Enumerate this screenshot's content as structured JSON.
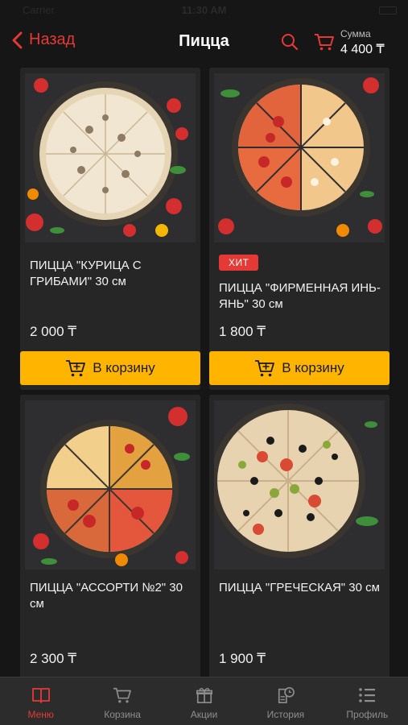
{
  "status": {
    "carrier": "Carrier",
    "time": "11:30 AM"
  },
  "header": {
    "back_label": "Назад",
    "title": "Пицца",
    "sum_label": "Сумма",
    "sum_value": "4 400 ₸",
    "icons": {
      "back": "chevron-left-icon",
      "search": "search-icon",
      "cart": "cart-icon"
    }
  },
  "colors": {
    "accent": "#e53935",
    "button": "#ffb400",
    "card": "#262626",
    "background": "#161616"
  },
  "products": [
    {
      "name": "ПИЦЦА \"КУРИЦА С ГРИБАМИ\" 30 см",
      "price": "2 000 ₸",
      "badge": "",
      "button": "В корзину"
    },
    {
      "name": "ПИЦЦА \"ФИРМЕННАЯ ИНЬ-ЯНЬ\" 30 см",
      "price": "1 800 ₸",
      "badge": "ХИТ",
      "button": "В корзину"
    },
    {
      "name": "ПИЦЦА \"АССОРТИ №2\" 30 см",
      "price": "2 300 ₸",
      "badge": "",
      "button": ""
    },
    {
      "name": "ПИЦЦА \"ГРЕЧЕСКАЯ\" 30 см",
      "price": "1 900 ₸",
      "badge": "",
      "button": ""
    }
  ],
  "tabbar": [
    {
      "label": "Меню",
      "icon": "book-icon",
      "active": true
    },
    {
      "label": "Корзина",
      "icon": "cart-icon",
      "active": false
    },
    {
      "label": "Акции",
      "icon": "gift-icon",
      "active": false
    },
    {
      "label": "История",
      "icon": "history-icon",
      "active": false
    },
    {
      "label": "Профиль",
      "icon": "list-icon",
      "active": false
    }
  ]
}
